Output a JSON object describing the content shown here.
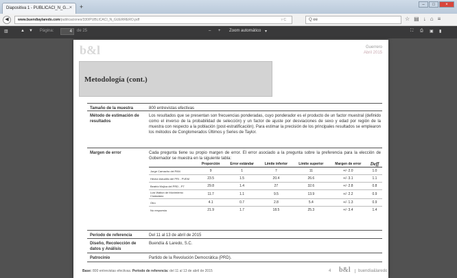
{
  "browser": {
    "tab_title": "Diapositiva 1 - PUBLICACI_N_G...",
    "tab_close": "×",
    "new_tab": "+",
    "url_host": "www.buendiaylaredo.com",
    "url_path": "/publicaciones/330/PUBLICACI_N_GUERRERO.pdf",
    "search_placeholder": "Q ee",
    "window_controls": [
      "–",
      "□",
      "×"
    ]
  },
  "pdf_toolbar": {
    "page_label": "Página:",
    "page_value": "4",
    "page_total": "de 25",
    "zoom_minus": "–",
    "zoom_plus": "+",
    "zoom_label": "Zoom automático"
  },
  "doc": {
    "logo": "b&l",
    "header_right_1": "Guerrero",
    "header_right_2": "Abril 2015",
    "title": "Metodología (cont.)",
    "rows": [
      {
        "label": "Tamaño de la muestra",
        "value": "800 entrevistas efectivas"
      },
      {
        "label": "Método de estimación de resultados",
        "value": "Los resultados que se presentan son frecuencias ponderadas, cuyo ponderador es el producto de un factor muestral (definido como el inverso de la probabilidad de selección) y un factor de ajuste por desviaciones de sexo y edad por región de la muestra con respecto a la población (post-estratificación). Para estimar la precisión de los principales resultados se emplearon los métodos de Conglomerados Últimos y Series de Taylor."
      },
      {
        "label": "Margen de error",
        "value": "Cada pregunta tiene su propio margen de error. El error asociado a la pregunta sobre la preferencia para la elección de Gobernador se muestra en la siguiente tabla:"
      },
      {
        "label": "Periodo de referencia",
        "value": "Del 11 al 13 de abril de 2015"
      },
      {
        "label": "Diseño, Recolección de datos y Análisis",
        "value": "Buendía & Laredo, S.C."
      },
      {
        "label": "Patrocinio",
        "value": "Partido de la Revolución Democrática (PRD)."
      }
    ],
    "table": {
      "headers": [
        "",
        "Proporción",
        "Error estándar",
        "Límite inferior",
        "Límite superior",
        "Margen de error",
        "Deff"
      ],
      "rows": [
        [
          "Jorge Camacho del PAN",
          "9",
          "1",
          "7",
          "11",
          "+/- 2.0",
          "1.0"
        ],
        [
          "Héctor Astudillo del PRI - PVEM",
          "23.5",
          "1.5",
          "20.4",
          "26.6",
          "+/- 3.1",
          "1.1"
        ],
        [
          "Beatriz Mojica del PRD - PT",
          "29.8",
          "1.4",
          "27",
          "32.6",
          "+/- 2.8",
          "0.8"
        ],
        [
          "Luis Walton de Movimiento Ciudadano",
          "11.7",
          "1.1",
          "9.5",
          "13.9",
          "+/- 2.2",
          "0.9"
        ],
        [
          "Otro",
          "4.1",
          "0.7",
          "2.8",
          "5.4",
          "+/- 1.3",
          "0.9"
        ],
        [
          "No respuesta",
          "21.9",
          "1.7",
          "18.5",
          "25.3",
          "+/- 3.4",
          "1.4"
        ]
      ]
    },
    "footer_base_label": "Base:",
    "footer_base_text": "800 entrevistas efectivas.",
    "footer_period_label": "Periodo de referencia:",
    "footer_period_text": "del 11 al 13 de abril de 2015",
    "page_number": "4",
    "footer_logo": "b&l",
    "footer_name": "buendía&laredo"
  }
}
